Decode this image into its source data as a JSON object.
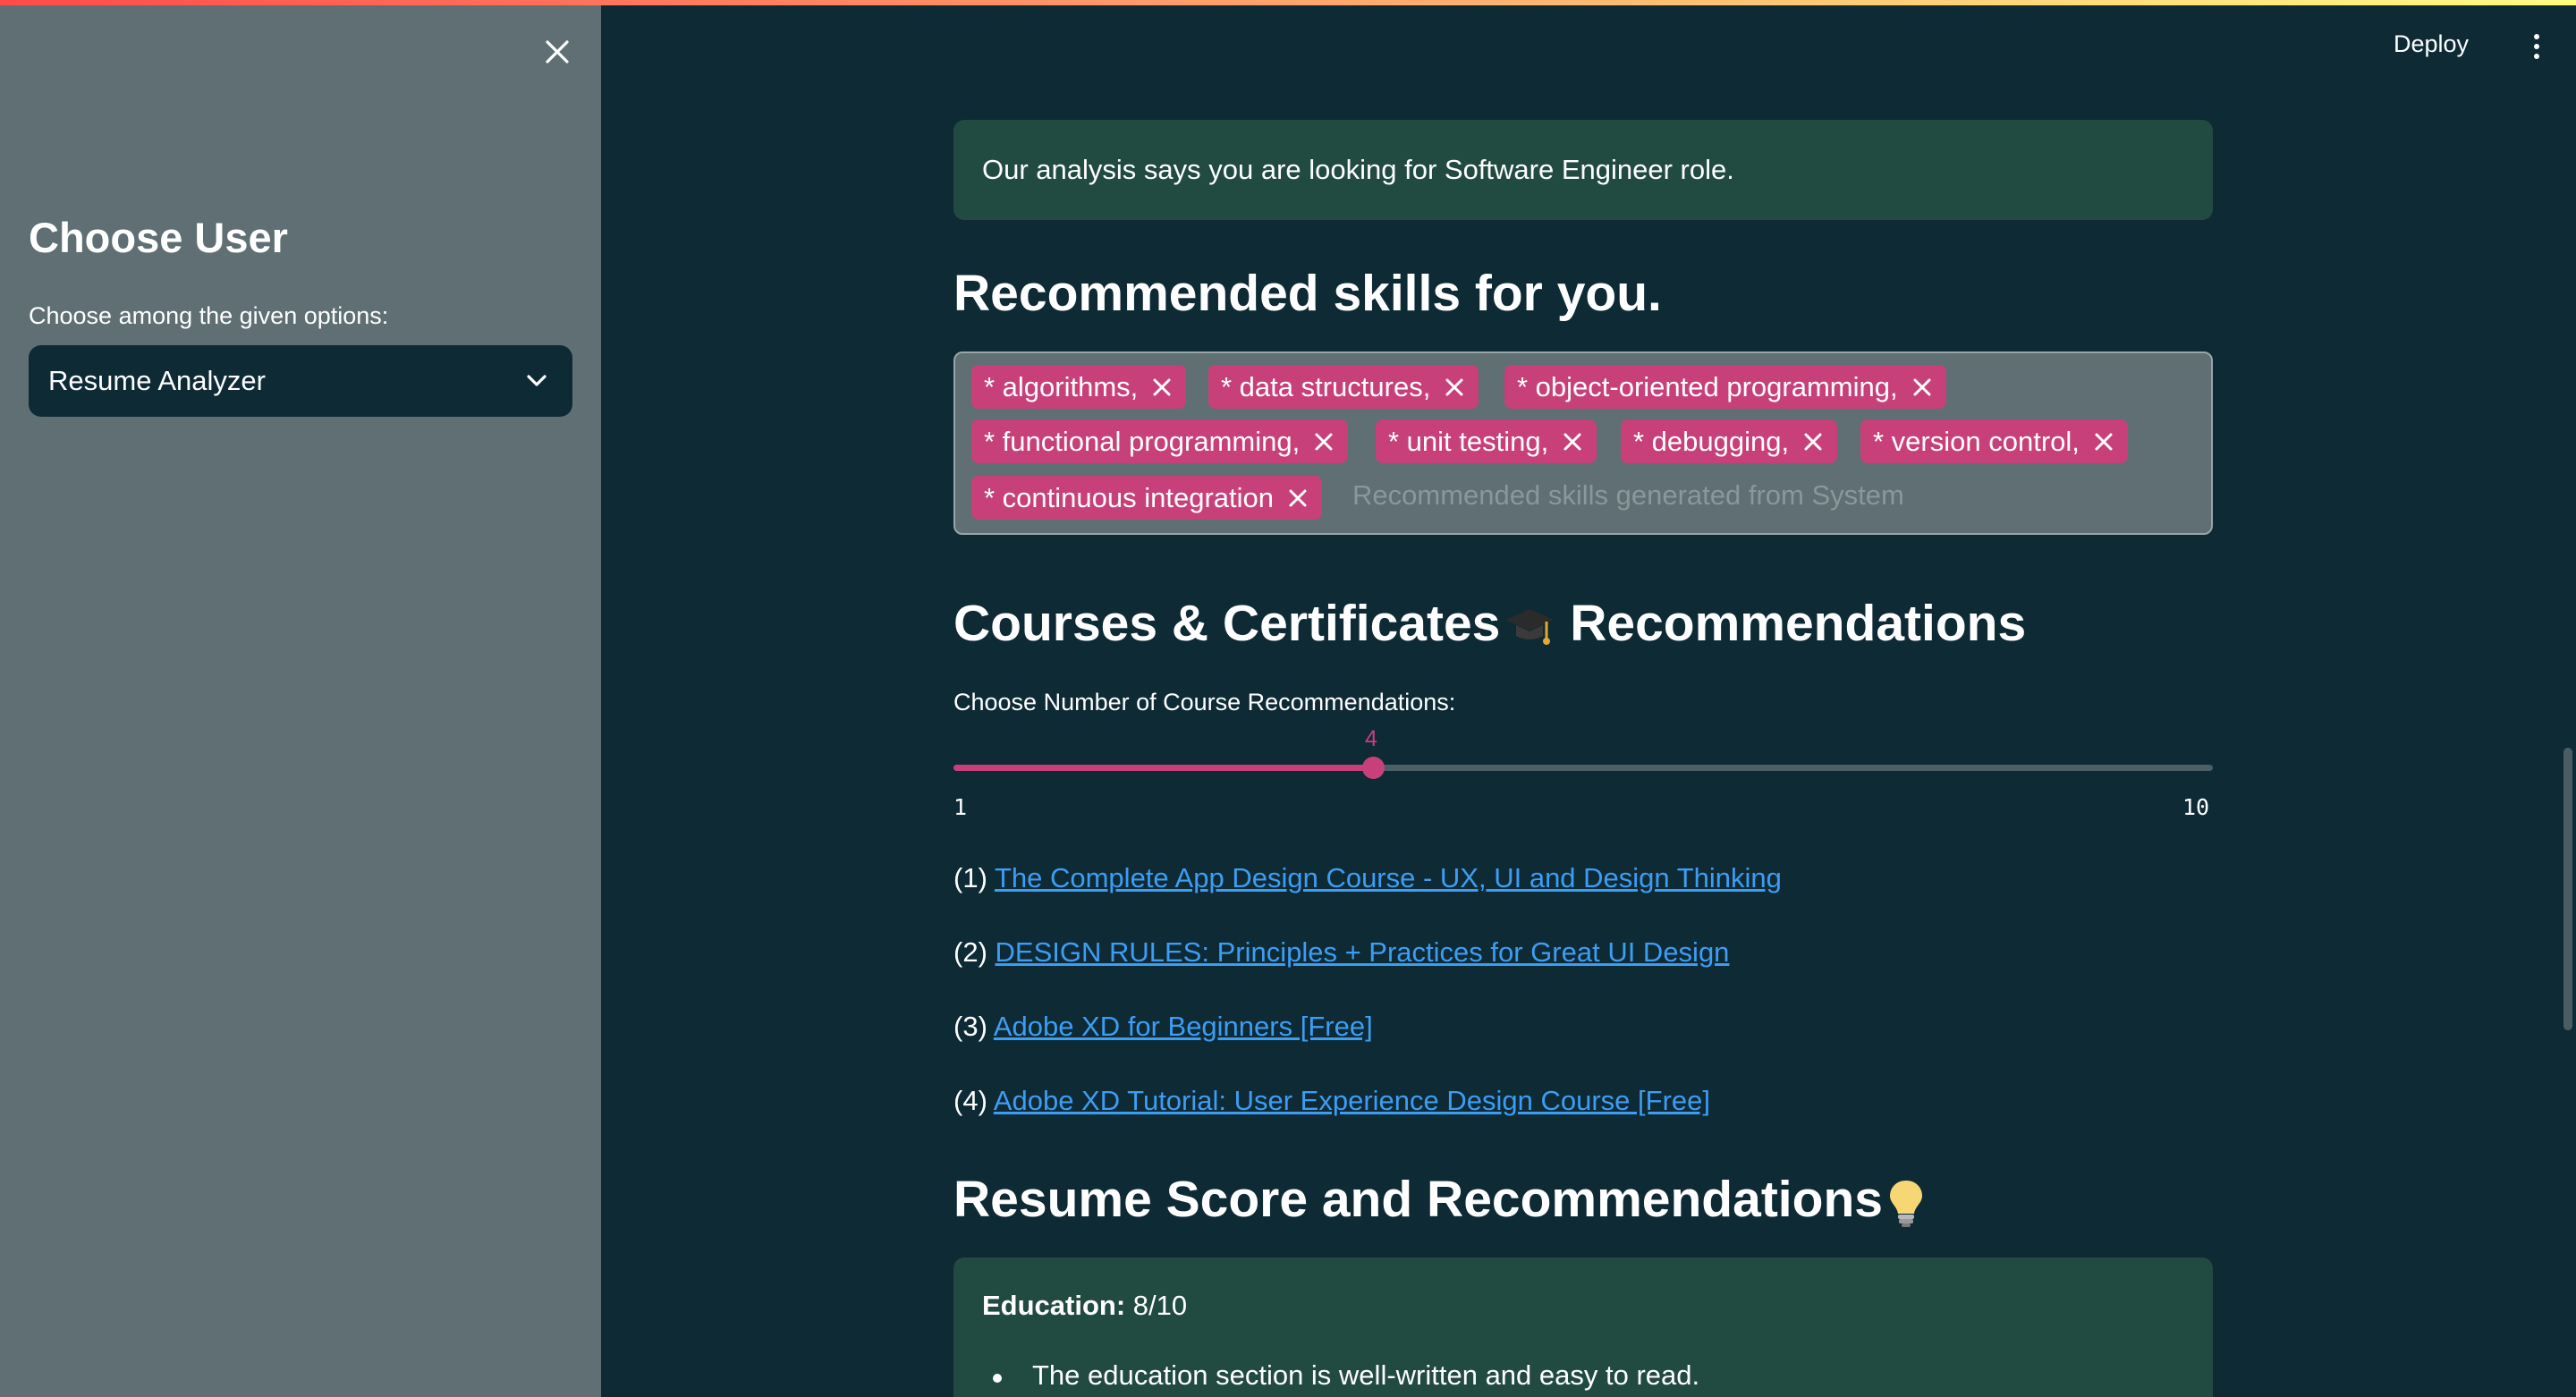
{
  "sidebar": {
    "title": "Choose User",
    "select_label": "Choose among the given options:",
    "select_value": "Resume Analyzer"
  },
  "header": {
    "deploy_label": "Deploy"
  },
  "main": {
    "role_message": "Our analysis says you are looking for Software Engineer role.",
    "skills_heading": "Recommended skills for you.",
    "skills": [
      "* algorithms,",
      "* data structures,",
      "* object-oriented programming,",
      "* functional programming,",
      "* unit testing,",
      "* debugging,",
      "* version control,",
      "* continuous integration"
    ],
    "skills_placeholder": "Recommended skills generated from System",
    "courses_heading": "Courses & Certificates",
    "courses_heading_suffix": "Recommendations",
    "slider_label": "Choose Number of Course Recommendations:",
    "slider": {
      "value": 4,
      "min": 1,
      "max": 10,
      "min_label": "1",
      "max_label": "10",
      "value_label": "4"
    },
    "courses": [
      {
        "num": "(1)",
        "title": "The Complete App Design Course - UX, UI and Design Thinking"
      },
      {
        "num": "(2)",
        "title": "DESIGN RULES: Principles + Practices for Great UI Design"
      },
      {
        "num": "(3)",
        "title": "Adobe XD for Beginners [Free]"
      },
      {
        "num": "(4)",
        "title": "Adobe XD Tutorial: User Experience Design Course [Free]"
      }
    ],
    "score_heading": "Resume Score and Recommendations",
    "score": {
      "label": "Education:",
      "value": "8/10",
      "bullets": [
        "The education section is well-written and easy to read."
      ]
    }
  },
  "colors": {
    "background": "#0e2a35",
    "sidebar": "#5f6f74",
    "accent": "#c8407a",
    "link": "#3d9df3",
    "success_box": "#214a40"
  },
  "icons": {
    "close": "close-icon",
    "chevron": "chevron-down-icon",
    "menu": "more-vertical-icon",
    "graduation": "graduation-cap-icon",
    "lightbulb": "lightbulb-icon"
  }
}
